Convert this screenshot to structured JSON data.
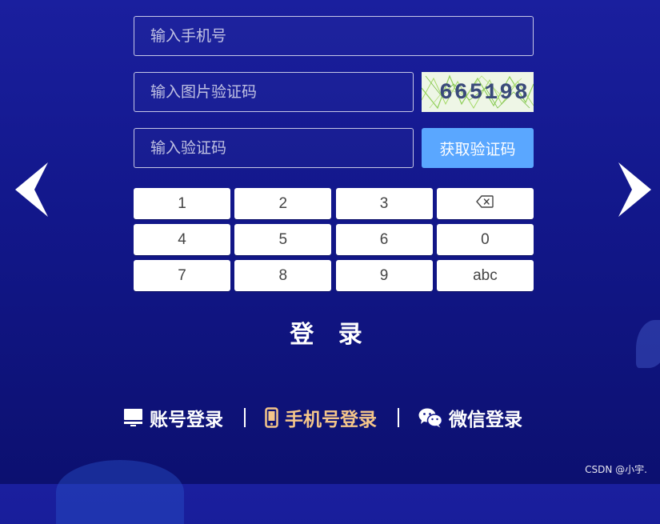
{
  "form": {
    "phone_placeholder": "输入手机号",
    "captcha_placeholder": "输入图片验证码",
    "sms_placeholder": "输入验证码",
    "get_code_label": "获取验证码",
    "captcha_text": "665198"
  },
  "keypad": {
    "keys": [
      "1",
      "2",
      "3",
      "backspace",
      "4",
      "5",
      "6",
      "0",
      "7",
      "8",
      "9",
      "abc"
    ]
  },
  "login_label": "登 录",
  "login_tabs": {
    "account": "账号登录",
    "phone": "手机号登录",
    "wechat": "微信登录"
  },
  "watermark": "CSDN @小宇.",
  "colors": {
    "accent_button": "#5aa7ff",
    "active_tab": "#f5c68a"
  }
}
